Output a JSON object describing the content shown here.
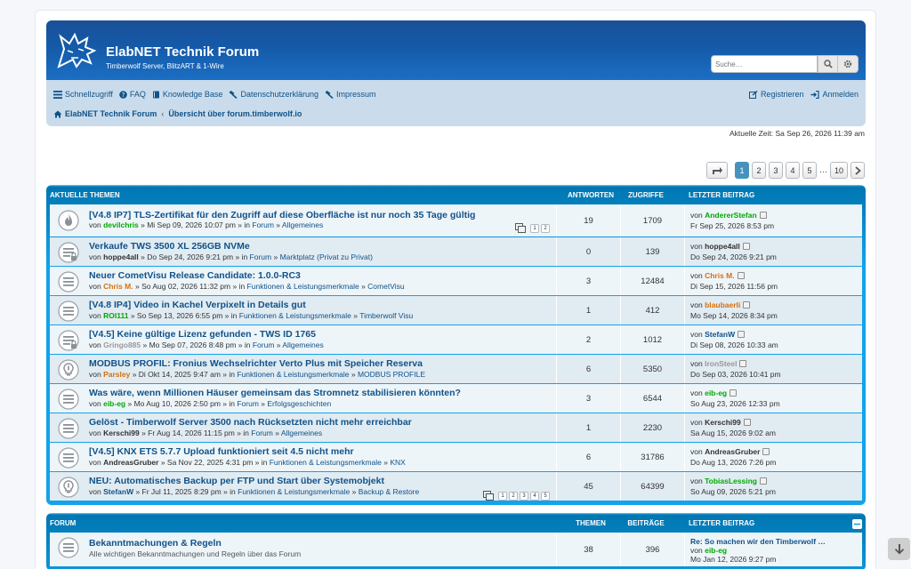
{
  "site": {
    "title": "ElabNET Technik Forum",
    "subtitle": "Timberwolf Server, BlitzART & 1-Wire"
  },
  "search": {
    "placeholder": "Suche…"
  },
  "nav": {
    "left": [
      "Schnellzugriff",
      "FAQ",
      "Knowledge Base",
      "Datenschutzerklärung",
      "Impressum"
    ],
    "right": [
      "Registrieren",
      "Anmelden"
    ]
  },
  "breadcrumbs": [
    "ElabNET Technik Forum",
    "Übersicht über forum.timberwolf.io"
  ],
  "current_time": "Aktuelle Zeit: Sa Sep 26, 2026 11:39 am",
  "pagination": {
    "pages": [
      "1",
      "2",
      "3",
      "4",
      "5"
    ],
    "ellipsis": "…",
    "last": "10",
    "active": "1"
  },
  "topics_header": {
    "title": "AKTUELLE THEMEN",
    "col1": "ANTWORTEN",
    "col2": "ZUGRIFFE",
    "col3": "LETZTER BEITRAG"
  },
  "topics": [
    {
      "icon": "hot-topic-icon",
      "title": "[V4.8 IP7] TLS-Zertifikat für den Zugriff auf diese Oberfläche ist nur noch 35 Tage gültig",
      "by": "von",
      "author": "devilchris",
      "author_color": "#00aa00",
      "date": " » Mi Sep 09, 2026 10:07 pm » in ",
      "forum": "Forum",
      "sub": "Allgemeines",
      "replies": "19",
      "views": "1709",
      "last_by": "von",
      "last_user": "AndererStefan",
      "last_color": "#00aa00",
      "last_date": "Fr Sep 25, 2026 8:53 pm",
      "mini_pages": [
        "1",
        "2"
      ]
    },
    {
      "icon": "locked-topic-icon",
      "title": "Verkaufe TWS 3500 XL 256GB NVMe",
      "by": "von",
      "author": "hoppe4all",
      "author_color": "#333333",
      "date": " » Do Sep 24, 2026 9:21 pm » in ",
      "forum": "Forum",
      "sub": "Marktplatz (Privat zu Privat)",
      "replies": "0",
      "views": "139",
      "last_by": "von",
      "last_user": "hoppe4all",
      "last_color": "#333333",
      "last_date": "Do Sep 24, 2026 9:21 pm",
      "mini_pages": []
    },
    {
      "icon": "topic-icon",
      "title": "Neuer CometVisu Release Candidate: 1.0.0-RC3",
      "by": "von",
      "author": "Chris M.",
      "author_color": "#d4710b",
      "date": " » So Aug 02, 2026 11:32 pm » in ",
      "forum": "Funktionen & Leistungsmerkmale",
      "sub": "CometVisu",
      "replies": "3",
      "views": "12484",
      "last_by": "von",
      "last_user": "Chris M.",
      "last_color": "#d4710b",
      "last_date": "Di Sep 15, 2026 11:56 pm",
      "mini_pages": []
    },
    {
      "icon": "topic-icon",
      "title": "[V4.8 IP4] Video in Kachel Verpixelt in Details gut",
      "by": "von",
      "author": "ROI111",
      "author_color": "#00aa00",
      "date": " » So Sep 13, 2026 6:55 pm » in ",
      "forum": "Funktionen & Leistungsmerkmale",
      "sub": "Timberwolf Visu",
      "replies": "1",
      "views": "412",
      "last_by": "von",
      "last_user": "blaubaerli",
      "last_color": "#d4710b",
      "last_date": "Mo Sep 14, 2026 8:34 pm",
      "mini_pages": []
    },
    {
      "icon": "locked-topic-icon",
      "title": "[V4.5] Keine gültige Lizenz gefunden - TWS ID 1765",
      "by": "von",
      "author": "Gringo885",
      "author_color": "#999999",
      "date": " » Mo Sep 07, 2026 8:48 pm » in ",
      "forum": "Forum",
      "sub": "Allgemeines",
      "replies": "2",
      "views": "1012",
      "last_by": "von",
      "last_user": "StefanW",
      "last_color": "#105289",
      "last_date": "Di Sep 08, 2026 10:33 am",
      "mini_pages": []
    },
    {
      "icon": "idea-topic-icon",
      "title": "MODBUS PROFIL: Fronius Wechselrichter Verto Plus mit Speicher Reserva",
      "by": "von",
      "author": "Parsley",
      "author_color": "#d4710b",
      "date": " » Di Okt 14, 2025 9:47 am » in ",
      "forum": "Funktionen & Leistungsmerkmale",
      "sub": "MODBUS PROFILE",
      "replies": "6",
      "views": "5350",
      "last_by": "von",
      "last_user": "IronSteel",
      "last_color": "#999999",
      "last_date": "Do Sep 03, 2026 10:41 pm",
      "mini_pages": []
    },
    {
      "icon": "topic-icon",
      "title": "Was wäre, wenn Millionen Häuser gemeinsam das Stromnetz stabilisieren könnten?",
      "by": "von",
      "author": "eib-eg",
      "author_color": "#00aa00",
      "date": " » Mo Aug 10, 2026 2:50 pm » in ",
      "forum": "Forum",
      "sub": "Erfolgsgeschichten",
      "replies": "3",
      "views": "6544",
      "last_by": "von",
      "last_user": "eib-eg",
      "last_color": "#00aa00",
      "last_date": "So Aug 23, 2026 12:33 pm",
      "mini_pages": []
    },
    {
      "icon": "topic-icon",
      "title": "Gelöst - Timberwolf Server 3500 nach Rücksetzten nicht mehr erreichbar",
      "by": "von",
      "author": "Kerschi99",
      "author_color": "#333333",
      "date": " » Fr Aug 14, 2026 11:15 pm » in ",
      "forum": "Forum",
      "sub": "Allgemeines",
      "replies": "1",
      "views": "2230",
      "last_by": "von",
      "last_user": "Kerschi99",
      "last_color": "#333333",
      "last_date": "Sa Aug 15, 2026 9:02 am",
      "mini_pages": []
    },
    {
      "icon": "topic-icon",
      "title": "[V4.5] KNX ETS 5.7.7 Upload funktioniert seit 4.5 nicht mehr",
      "by": "von",
      "author": "AndreasGruber",
      "author_color": "#333333",
      "date": " » Sa Nov 22, 2025 4:31 pm » in ",
      "forum": "Funktionen & Leistungsmerkmale",
      "sub": "KNX",
      "replies": "6",
      "views": "31786",
      "last_by": "von",
      "last_user": "AndreasGruber",
      "last_color": "#333333",
      "last_date": "Do Aug 13, 2026 7:26 pm",
      "mini_pages": []
    },
    {
      "icon": "idea-topic-icon",
      "title": "NEU: Automatisches Backup per FTP und Start über Systemobjekt",
      "by": "von",
      "author": "StefanW",
      "author_color": "#105289",
      "date": " » Fr Jul 11, 2025 8:29 pm » in ",
      "forum": "Funktionen & Leistungsmerkmale",
      "sub": "Backup & Restore",
      "replies": "45",
      "views": "64399",
      "last_by": "von",
      "last_user": "TobiasLessing",
      "last_color": "#00aa00",
      "last_date": "So Aug 09, 2026 5:21 pm",
      "mini_pages": [
        "1",
        "2",
        "3",
        "4",
        "5"
      ]
    }
  ],
  "forum_header": {
    "title": "FORUM",
    "col1": "THEMEN",
    "col2": "BEITRÄGE",
    "col3": "LETZTER BEITRAG"
  },
  "forums": [
    {
      "title": "Bekanntmachungen & Regeln",
      "desc": "Alle wichtigen Bekanntmachungen und Regeln über das Forum",
      "topics": "38",
      "posts": "396",
      "last_title": "Re: So machen wir den Timberwolf …",
      "last_by": "von",
      "last_user": "eib-eg",
      "last_color": "#00aa00",
      "last_date": "Mo Jan 12, 2026 9:27 pm"
    }
  ],
  "colors": {
    "banner": "#1a4f97",
    "navbar": "#cadceb",
    "panel": "#12a3eb",
    "link": "#105289"
  }
}
